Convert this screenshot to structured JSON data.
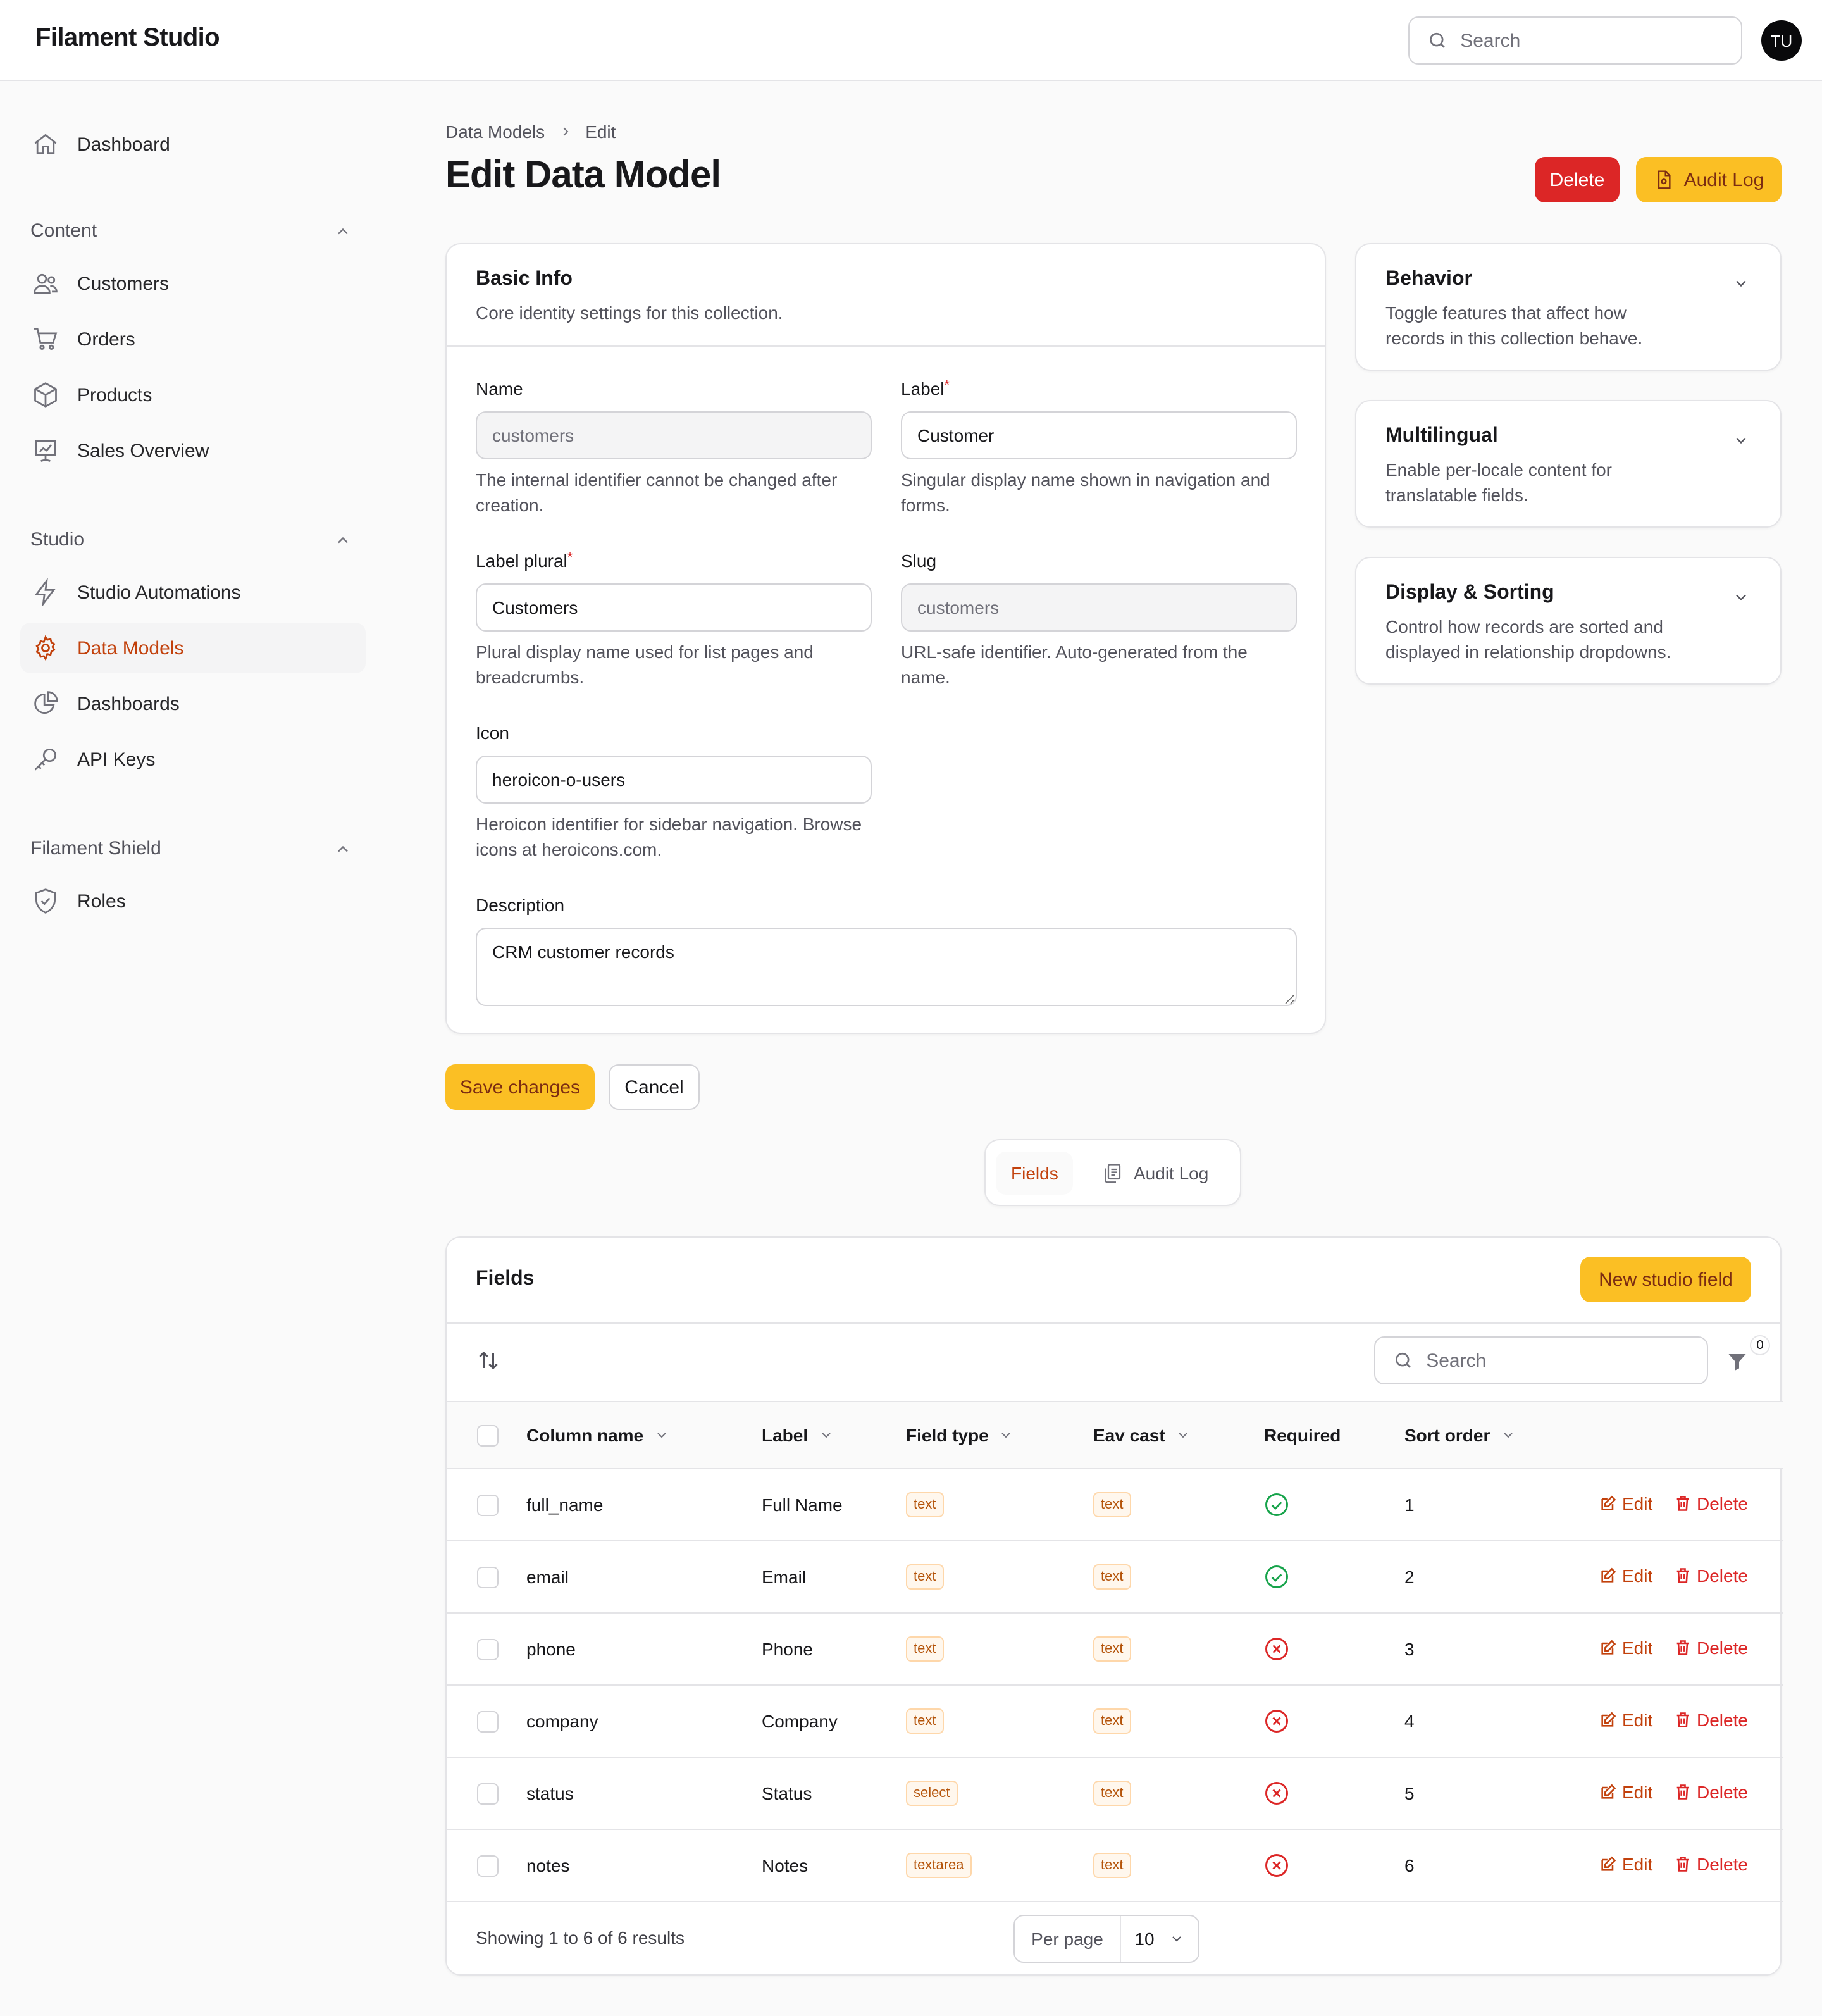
{
  "app": {
    "title": "Filament Studio"
  },
  "topbar": {
    "search_placeholder": "Search",
    "avatar_initials": "TU"
  },
  "sidebar": {
    "dashboard": "Dashboard",
    "groups": [
      {
        "label": "Content",
        "items": [
          "Customers",
          "Orders",
          "Products",
          "Sales Overview"
        ]
      },
      {
        "label": "Studio",
        "items": [
          "Studio Automations",
          "Data Models",
          "Dashboards",
          "API Keys"
        ]
      },
      {
        "label": "Filament Shield",
        "items": [
          "Roles"
        ]
      }
    ],
    "active_item": "Data Models"
  },
  "breadcrumb": [
    "Data Models",
    "Edit"
  ],
  "page": {
    "title": "Edit Data Model",
    "delete_label": "Delete",
    "audit_log_label": "Audit Log"
  },
  "basic_info": {
    "title": "Basic Info",
    "description": "Core identity settings for this collection.",
    "fields": {
      "name": {
        "label": "Name",
        "value": "customers",
        "hint": "The internal identifier cannot be changed after creation."
      },
      "label": {
        "label": "Label",
        "value": "Customer",
        "hint": "Singular display name shown in navigation and forms."
      },
      "label_plural": {
        "label": "Label plural",
        "value": "Customers",
        "hint": "Plural display name used for list pages and breadcrumbs."
      },
      "slug": {
        "label": "Slug",
        "value": "customers",
        "hint": "URL-safe identifier. Auto-generated from the name."
      },
      "icon": {
        "label": "Icon",
        "value": "heroicon-o-users",
        "hint": "Heroicon identifier for sidebar navigation. Browse icons at heroicons.com."
      },
      "description": {
        "label": "Description",
        "value": "CRM customer records"
      }
    },
    "required_marker": "*"
  },
  "side_sections": [
    {
      "title": "Behavior",
      "description": "Toggle features that affect how records in this collection behave."
    },
    {
      "title": "Multilingual",
      "description": "Enable per-locale content for translatable fields."
    },
    {
      "title": "Display & Sorting",
      "description": "Control how records are sorted and displayed in relationship dropdowns."
    }
  ],
  "form_actions": {
    "save": "Save changes",
    "cancel": "Cancel"
  },
  "tabs": [
    {
      "label": "Fields",
      "active": true
    },
    {
      "label": "Audit Log",
      "active": false
    }
  ],
  "fields_table": {
    "title": "Fields",
    "new_button": "New studio field",
    "search_placeholder": "Search",
    "filter_count": "0",
    "columns": [
      "Column name",
      "Label",
      "Field type",
      "Eav cast",
      "Required",
      "Sort order"
    ],
    "rows": [
      {
        "column_name": "full_name",
        "label": "Full Name",
        "field_type": "text",
        "eav_cast": "text",
        "required": true,
        "sort_order": "1"
      },
      {
        "column_name": "email",
        "label": "Email",
        "field_type": "text",
        "eav_cast": "text",
        "required": true,
        "sort_order": "2"
      },
      {
        "column_name": "phone",
        "label": "Phone",
        "field_type": "text",
        "eav_cast": "text",
        "required": false,
        "sort_order": "3"
      },
      {
        "column_name": "company",
        "label": "Company",
        "field_type": "text",
        "eav_cast": "text",
        "required": false,
        "sort_order": "4"
      },
      {
        "column_name": "status",
        "label": "Status",
        "field_type": "select",
        "eav_cast": "text",
        "required": false,
        "sort_order": "5"
      },
      {
        "column_name": "notes",
        "label": "Notes",
        "field_type": "textarea",
        "eav_cast": "text",
        "required": false,
        "sort_order": "6"
      }
    ],
    "row_edit_label": "Edit",
    "row_delete_label": "Delete",
    "summary": "Showing 1 to 6 of 6 results",
    "per_page_label": "Per page",
    "per_page_value": "10"
  },
  "colors": {
    "primary": "#fbbf24",
    "danger": "#dc2626",
    "accent_text": "#c2410c",
    "success": "#16a34a"
  }
}
